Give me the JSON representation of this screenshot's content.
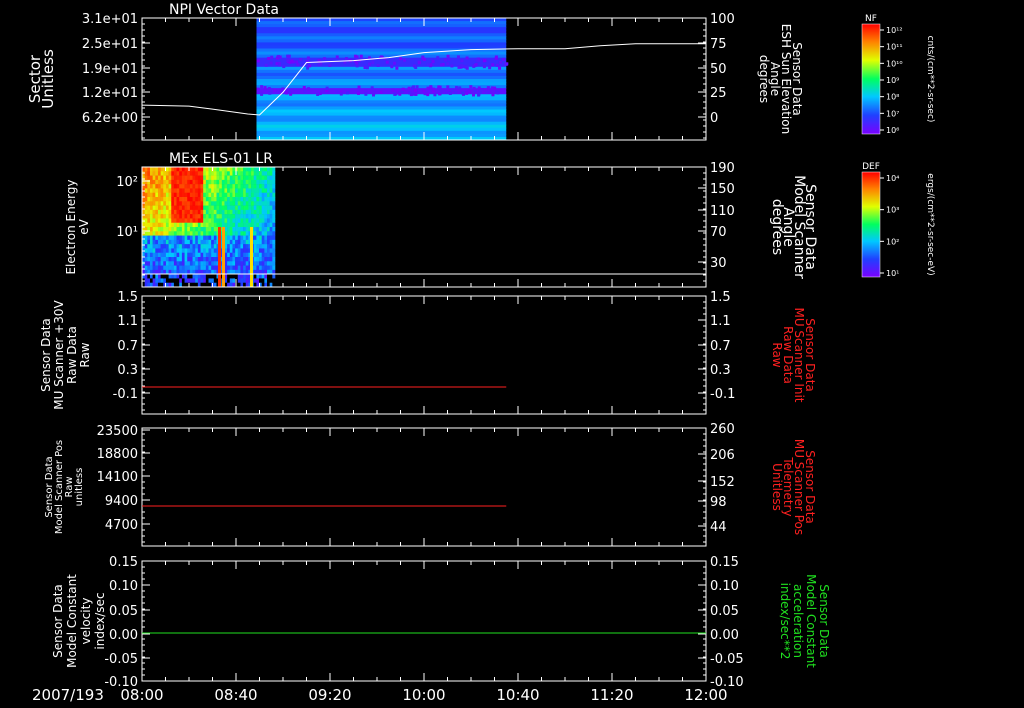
{
  "date_label": "2007/193",
  "time_ticks": [
    "08:00",
    "08:40",
    "09:20",
    "10:00",
    "10:40",
    "11:20",
    "12:00"
  ],
  "colors": {
    "axis": "#ffffff",
    "red": "#ff2020",
    "green": "#20e020",
    "bg": "#000000"
  },
  "colorbars": [
    {
      "id": "nf",
      "title": "NF",
      "unit": "cnts/(cm**2-sr-sec)",
      "ticks": [
        "10¹²",
        "10¹¹",
        "10¹⁰",
        "10⁹",
        "10⁸",
        "10⁷",
        "10⁶"
      ]
    },
    {
      "id": "def",
      "title": "DEF",
      "unit": "ergs/(cm**2-sr-sec-eV)",
      "ticks": [
        "10⁴",
        "10³",
        "10²",
        "10¹"
      ]
    }
  ],
  "chart_data": [
    {
      "type": "heatmap",
      "title": "NPI Vector Data",
      "ylabel": [
        "Sector",
        "Unitless"
      ],
      "yticks": [
        "3.1e+01",
        "2.5e+01",
        "1.9e+01",
        "1.2e+01",
        "6.2e+00"
      ],
      "right_label": [
        "Sensor Data",
        "ESH Sun Elevation",
        "Angle",
        "degrees"
      ],
      "right_ticks": [
        "100",
        "75",
        "50",
        "25",
        "0"
      ],
      "right_ylim": [
        -20,
        100
      ],
      "overlay_line": {
        "x": [
          "08:00",
          "08:20",
          "08:30",
          "08:45",
          "08:50",
          "09:00",
          "09:10",
          "09:30",
          "09:45",
          "10:00",
          "10:20",
          "10:40",
          "11:00",
          "11:15",
          "11:30",
          "11:50",
          "12:00"
        ],
        "y": [
          12,
          11,
          8,
          3,
          2,
          25,
          55,
          57,
          60,
          65,
          68,
          69,
          69,
          72,
          74,
          74,
          74
        ]
      },
      "data_window": [
        "08:50",
        "10:35"
      ]
    },
    {
      "type": "heatmap",
      "title": "MEx ELS-01 LR",
      "ylabel": [
        "Electron Energy",
        "eV"
      ],
      "yticks": [
        "10²",
        "10¹"
      ],
      "right_label": [
        "Sensor Data",
        "Model Scanner",
        "Angle",
        "degrees"
      ],
      "right_ticks": [
        "190",
        "150",
        "110",
        "70",
        "30"
      ],
      "right_ylim": [
        0,
        190
      ],
      "data_window": [
        "08:00",
        "09:00"
      ],
      "overlay_line": {
        "x": [
          "08:00",
          "12:00"
        ],
        "y": [
          10,
          10
        ]
      }
    },
    {
      "type": "line",
      "ylabel": [
        "Sensor Data",
        "MU Scanner +30V",
        "Raw Data",
        "Raw"
      ],
      "yticks": [
        "1.5",
        "1.1",
        "0.7",
        "0.3",
        "-0.1"
      ],
      "ylim": [
        -0.3,
        1.5
      ],
      "right_ticks": [
        "1.5",
        "1.1",
        "0.7",
        "0.3",
        "-0.1"
      ],
      "right_label": [
        "Sensor Data",
        "MU Scanner Init",
        "Raw Data",
        "Raw"
      ],
      "series": [
        {
          "x": [
            "08:00",
            "10:35"
          ],
          "y": [
            0,
            0
          ],
          "color": "red"
        }
      ]
    },
    {
      "type": "line",
      "ylabel": [
        "Sensor Data",
        "Model Scanner Pos",
        "Raw",
        "unitless"
      ],
      "yticks": [
        "23500",
        "18800",
        "14100",
        "9400",
        "4700"
      ],
      "ylim": [
        0,
        23500
      ],
      "right_ticks": [
        "260",
        "206",
        "152",
        "98",
        "44"
      ],
      "right_label": [
        "Sensor Data",
        "MU Scanner Pos",
        "Telemetry",
        "Unitless"
      ],
      "series": [
        {
          "x": [
            "08:00",
            "10:35"
          ],
          "y": [
            8300,
            8300
          ],
          "color": "red"
        }
      ]
    },
    {
      "type": "line",
      "ylabel": [
        "Sensor Data",
        "Model Constant",
        "velocity",
        "index/sec"
      ],
      "yticks": [
        "0.15",
        "0.10",
        "0.05",
        "0.00",
        "-0.05",
        "-0.10"
      ],
      "ylim": [
        -0.1,
        0.15
      ],
      "right_ticks": [
        "0.15",
        "0.10",
        "0.05",
        "0.00",
        "-0.05",
        "-0.10"
      ],
      "right_label": [
        "Sensor Data",
        "Model Constant",
        "acceleration",
        "index/sec**2"
      ],
      "series": [
        {
          "x": [
            "08:00",
            "12:00"
          ],
          "y": [
            0,
            0
          ],
          "color": "green"
        }
      ]
    }
  ]
}
